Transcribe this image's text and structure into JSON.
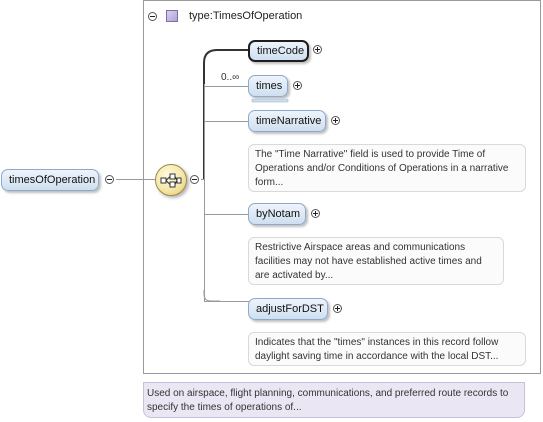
{
  "type_box": {
    "label": "type:TimesOfOperation"
  },
  "root": {
    "label": "timesOfOperation"
  },
  "children": {
    "timeCode": {
      "label": "timeCode"
    },
    "times": {
      "label": "times",
      "multiplicity": "0..∞"
    },
    "timeNarrative": {
      "label": "timeNarrative",
      "doc": "The \"Time Narrative\" field is used to provide Time of Operations and/or Conditions of Operations in a narrative form..."
    },
    "byNotam": {
      "label": "byNotam",
      "doc": "Restrictive Airspace areas and communications facilities may not have established active times and are activated by..."
    },
    "adjustForDST": {
      "label": "adjustForDST",
      "doc": "Indicates that the \"times\" instances in this record follow daylight saving time in accordance with the local DST..."
    }
  },
  "root_doc": "Used on airspace, flight planning, communications, and preferred route records to specify the times of operations of...",
  "icons": {
    "collapse": "minus-circle-icon",
    "expand": "plus-circle-icon",
    "type": "complex-type-icon",
    "compositor": "sequence-compositor-icon"
  }
}
